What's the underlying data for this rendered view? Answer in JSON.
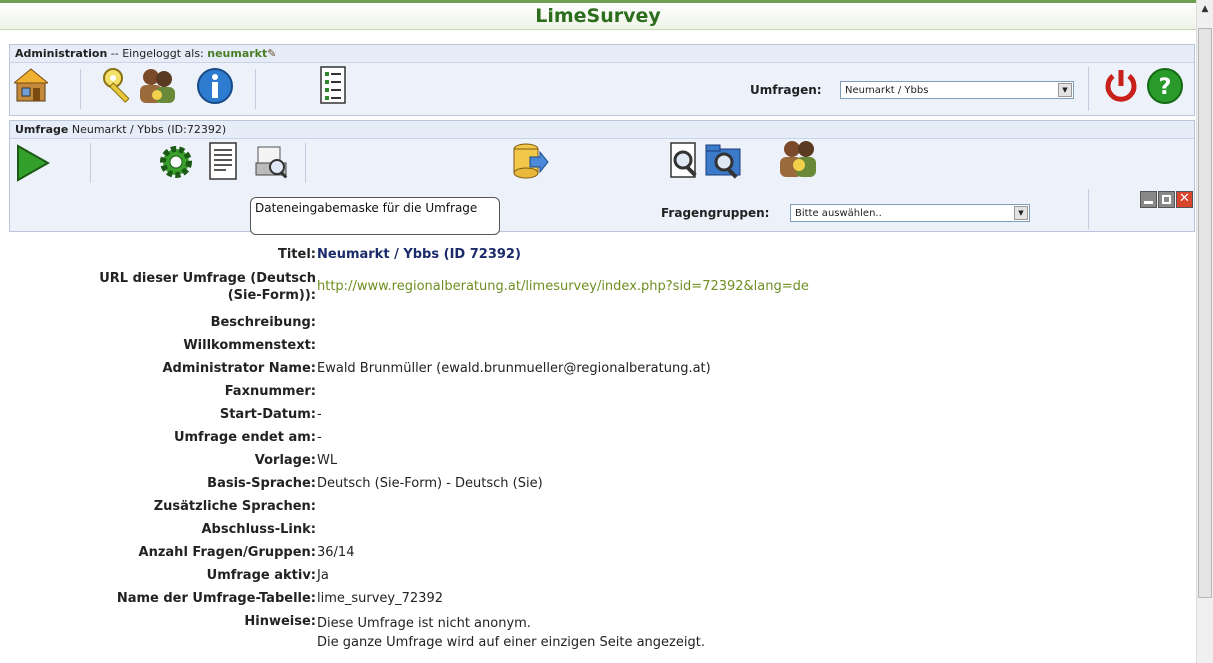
{
  "app": {
    "title": "LimeSurvey"
  },
  "admin_bar": {
    "label": "Administration",
    "sep": " -- Eingeloggt als: ",
    "user": "neumarkt",
    "surveys_label": "Umfragen:",
    "surveys_selected": "Neumarkt / Ybbs"
  },
  "survey_bar": {
    "label": "Umfrage",
    "name": " Neumarkt / Ybbs (ID:72392)",
    "groups_label": "Fragengruppen:",
    "groups_selected": "Bitte auswählen..",
    "tooltip": "Dateneingabemaske für die Umfrage"
  },
  "details": [
    {
      "key": "Titel:",
      "value": "Neumarkt / Ybbs (ID 72392)"
    },
    {
      "key": "URL dieser Umfrage (Deutsch",
      "key2": "(Sie-Form)):",
      "value": "http://www.regionalberatung.at/limesurvey/index.php?sid=72392&lang=de"
    },
    {
      "key": "Beschreibung:",
      "value": ""
    },
    {
      "key": "Willkommenstext:",
      "value": ""
    },
    {
      "key": "Administrator Name:",
      "value": "Ewald Brunmüller (ewald.brunmueller@regionalberatung.at)"
    },
    {
      "key": "Faxnummer:",
      "value": ""
    },
    {
      "key": "Start-Datum:",
      "value": "-"
    },
    {
      "key": "Umfrage endet am:",
      "value": "-"
    },
    {
      "key": "Vorlage:",
      "value": "WL"
    },
    {
      "key": "Basis-Sprache:",
      "value": "Deutsch (Sie-Form) - Deutsch (Sie)"
    },
    {
      "key": "Zusätzliche Sprachen:",
      "value": ""
    },
    {
      "key": "Abschluss-Link:",
      "value": ""
    },
    {
      "key": "Anzahl Fragen/Gruppen:",
      "value": "36/14"
    },
    {
      "key": "Umfrage aktiv:",
      "value": "Ja"
    },
    {
      "key": "Name der Umfrage-Tabelle:",
      "value": "lime_survey_72392"
    },
    {
      "key": "Hinweise:",
      "value": "Diese Umfrage ist nicht anonym.",
      "value2": "Die ganze Umfrage wird auf einer einzigen Seite angezeigt."
    }
  ],
  "colors": {
    "accent": "#2c6e1e",
    "panel": "#edf2fa",
    "link": "#6f8f22"
  }
}
